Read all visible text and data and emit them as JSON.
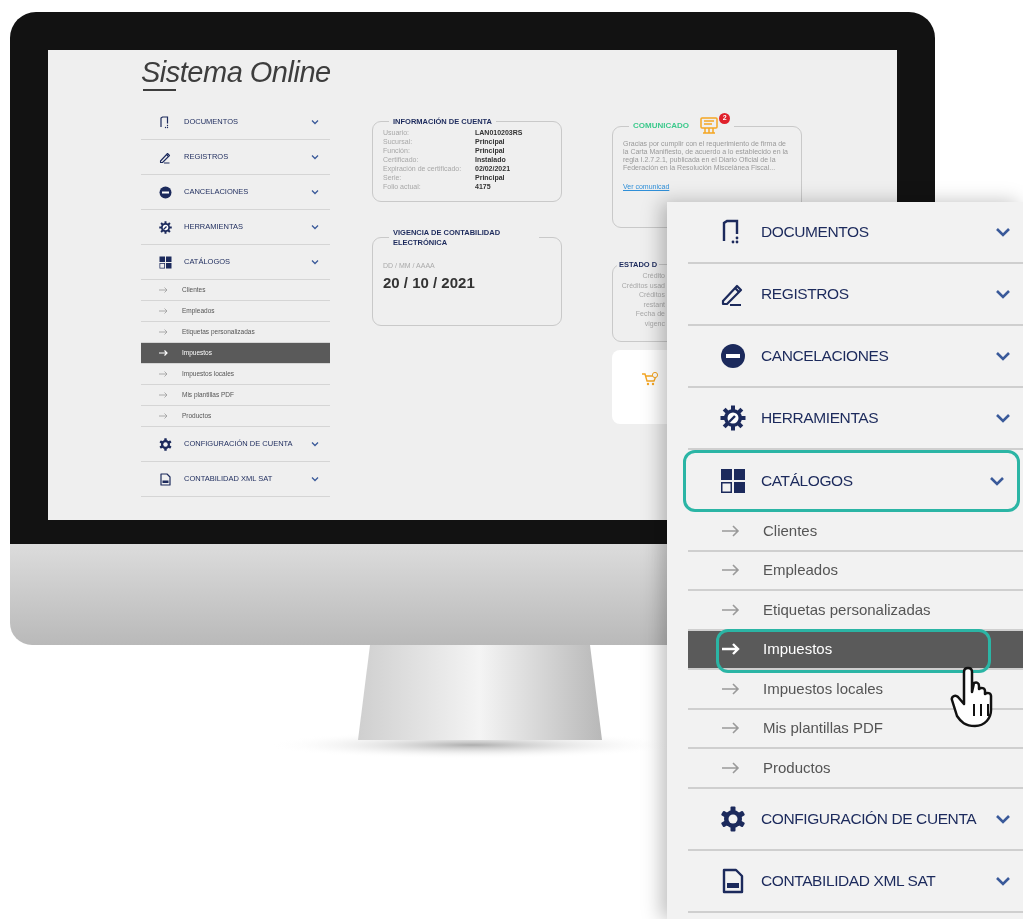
{
  "app": {
    "logo": "Sistema Online"
  },
  "sidebar": {
    "items": [
      {
        "label": "DOCUMENTOS",
        "kind": "document"
      },
      {
        "label": "REGISTROS",
        "kind": "pencil"
      },
      {
        "label": "CANCELACIONES",
        "kind": "cancel"
      },
      {
        "label": "HERRAMIENTAS",
        "kind": "tools"
      },
      {
        "label": "CATÁLOGOS",
        "kind": "catalog",
        "children": [
          {
            "label": "Clientes",
            "selected": false
          },
          {
            "label": "Empleados",
            "selected": false
          },
          {
            "label": "Etiquetas personalizadas",
            "selected": false
          },
          {
            "label": "Impuestos",
            "selected": true
          },
          {
            "label": "Impuestos locales",
            "selected": false
          },
          {
            "label": "Mis plantillas PDF",
            "selected": false
          },
          {
            "label": "Productos",
            "selected": false
          }
        ]
      },
      {
        "label": "CONFIGURACIÓN DE CUENTA",
        "kind": "gear"
      },
      {
        "label": "CONTABILIDAD XML SAT",
        "kind": "xml"
      }
    ]
  },
  "account_info": {
    "title": "INFORMACIÓN DE CUENTA",
    "rows": [
      {
        "label": "Usuario:",
        "value": "LAN010203RS"
      },
      {
        "label": "Sucursal:",
        "value": "Principal"
      },
      {
        "label": "Función:",
        "value": "Principal"
      },
      {
        "label": "Certificado:",
        "value": "Instalado"
      },
      {
        "label": "Expiración de certificado:",
        "value": "02/02/2021"
      },
      {
        "label": "Serie:",
        "value": "Principal"
      },
      {
        "label": "Folio actual:",
        "value": "4175"
      }
    ]
  },
  "vigencia": {
    "title": "VIGENCIA DE CONTABILIDAD ELECTRÓNICA",
    "date_format": "DD / MM / AAAA",
    "date": "20 / 10 / 2021"
  },
  "comunicado": {
    "title": "COMUNICADO",
    "badge": "2",
    "text": "Gracias por cumplir con el requerimiento de firma de la Carta Manifiesto, de acuerdo a lo establecido en la regla I.2.7.2.1, publicada en el Diario Oficial de la Federación en la Resolución Miscelánea Fiscal...",
    "link": "Ver comunicad"
  },
  "estado": {
    "title": "ESTADO D",
    "labels": [
      "Crédito",
      "Créditos usad",
      "Créditos restant",
      "Fecha de vigenc"
    ]
  },
  "zoom_callout": {
    "items": [
      {
        "label": "DOCUMENTOS",
        "kind": "document",
        "highlighted": false
      },
      {
        "label": "REGISTROS",
        "kind": "pencil",
        "highlighted": false
      },
      {
        "label": "CANCELACIONES",
        "kind": "cancel",
        "highlighted": false
      },
      {
        "label": "HERRAMIENTAS",
        "kind": "tools",
        "highlighted": false
      },
      {
        "label": "CATÁLOGOS",
        "kind": "catalog",
        "highlighted": true,
        "children": [
          {
            "label": "Clientes",
            "selected": false,
            "highlighted": false
          },
          {
            "label": "Empleados",
            "selected": false,
            "highlighted": false
          },
          {
            "label": "Etiquetas personalizadas",
            "selected": false,
            "highlighted": false
          },
          {
            "label": "Impuestos",
            "selected": true,
            "highlighted": true
          },
          {
            "label": "Impuestos locales",
            "selected": false,
            "highlighted": false
          },
          {
            "label": "Mis plantillas PDF",
            "selected": false,
            "highlighted": false
          },
          {
            "label": "Productos",
            "selected": false,
            "highlighted": false
          }
        ]
      },
      {
        "label": "CONFIGURACIÓN DE CUENTA",
        "kind": "gear",
        "highlighted": false
      },
      {
        "label": "CONTABILIDAD XML SAT",
        "kind": "xml",
        "highlighted": false
      }
    ]
  }
}
